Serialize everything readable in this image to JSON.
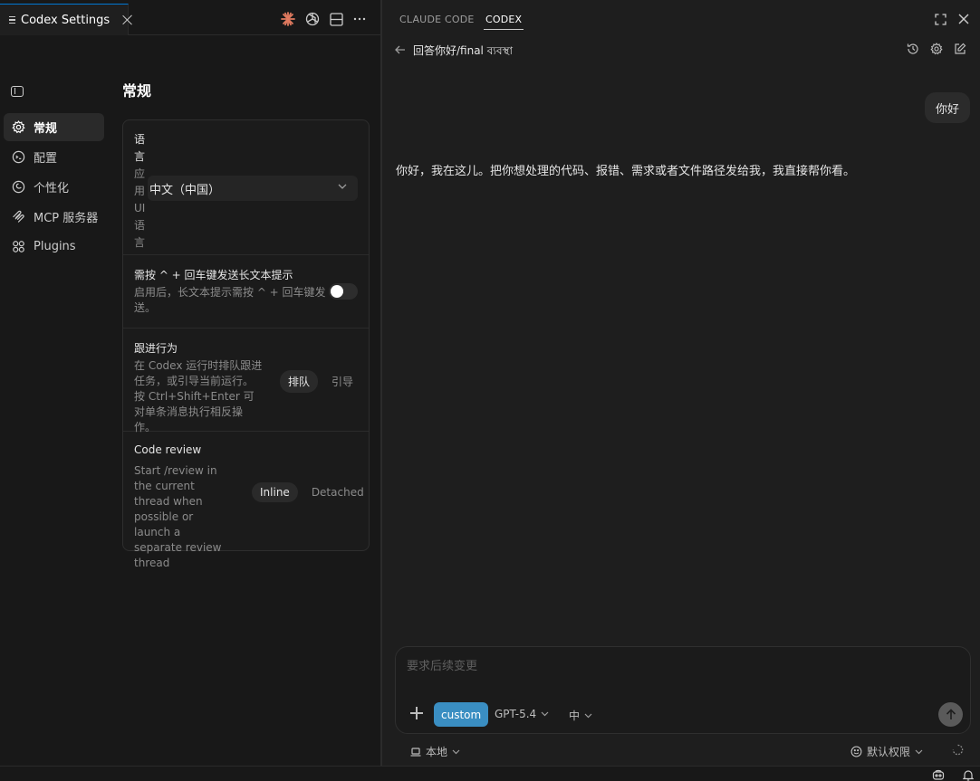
{
  "editor": {
    "tab_title": "Codex Settings",
    "toolbar_icons": [
      "claude-icon",
      "openai-icon",
      "split-editor-icon",
      "more-icon"
    ]
  },
  "settings": {
    "nav": [
      {
        "label": "常规",
        "icon": "gear-icon",
        "active": true
      },
      {
        "label": "配置",
        "icon": "config-icon",
        "active": false
      },
      {
        "label": "个性化",
        "icon": "personalize-icon",
        "active": false
      },
      {
        "label": "MCP 服务器",
        "icon": "mcp-icon",
        "active": false
      },
      {
        "label": "Plugins",
        "icon": "plugins-icon",
        "active": false
      }
    ],
    "title": "常规",
    "language": {
      "title": "语言",
      "description": "应用 UI 语言",
      "value": "中文（中国）"
    },
    "ctrl_enter": {
      "title": "需按 ^ + 回车键发送长文本提示",
      "description": "启用后，长文本提示需按 ^ + 回车键发送。",
      "enabled": false
    },
    "follow_up": {
      "title": "跟进行为",
      "description": "在 Codex 运行时排队跟进任务，或引导当前运行。按 Ctrl+Shift+Enter 可对单条消息执行相反操作。",
      "options": [
        "排队",
        "引导"
      ],
      "selected": "排队"
    },
    "code_review": {
      "title": "Code review",
      "description": "Start /review in the current thread when possible or launch a separate review thread",
      "options": [
        "Inline",
        "Detached"
      ],
      "selected": "Inline"
    }
  },
  "panel": {
    "tabs": [
      "CLAUDE CODE",
      "CODEX"
    ],
    "active_tab": "CODEX",
    "thread_title": "回答你好/final ব্যবস্থা",
    "messages": {
      "user": "你好",
      "assistant": "你好，我在这儿。把你想处理的代码、报错、需求或者文件路径发给我，我直接帮你看。"
    },
    "composer": {
      "placeholder": "要求后续变更",
      "custom_label": "custom",
      "model": "GPT-5.4",
      "effort": "中"
    },
    "footer": {
      "location": "本地",
      "permissions": "默认权限"
    }
  },
  "colors": {
    "accent": "#3a8ec2",
    "claude": "#e07a5f",
    "focus": "#0078d4"
  }
}
